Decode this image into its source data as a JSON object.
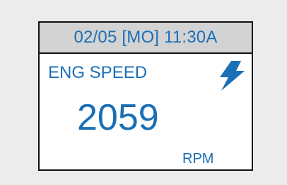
{
  "display": {
    "header": {
      "text": "02/05 [MO] 11:30A"
    },
    "parameter_label": "ENG SPEED",
    "value": "2059",
    "unit": "RPM",
    "status_icon": "lightning-bolt-icon"
  },
  "colors": {
    "accent": "#1b6fb5",
    "header_bg": "#d3d3d3",
    "border": "#111111",
    "background": "#ececec",
    "screen_bg": "#ffffff"
  }
}
